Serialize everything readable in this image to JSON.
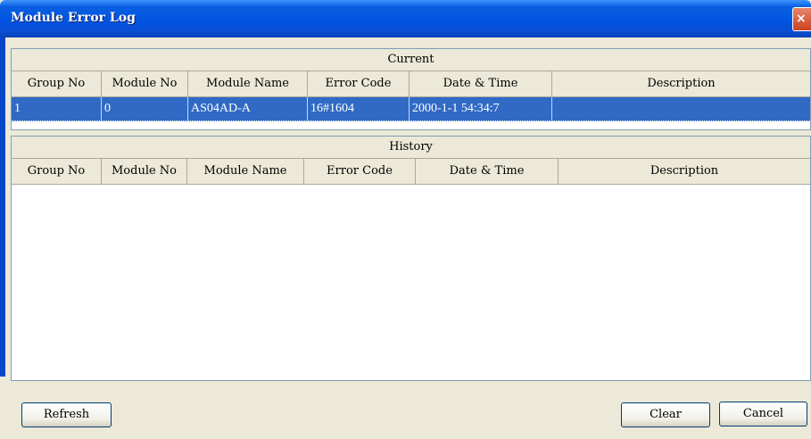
{
  "window": {
    "title": "Module Error Log",
    "close_glyph": "×"
  },
  "current": {
    "caption": "Current",
    "columns": [
      "Group No",
      "Module No",
      "Module Name",
      "Error Code",
      "Date & Time",
      "Description"
    ],
    "rows": [
      {
        "group_no": "1",
        "module_no": "0",
        "module_name": "AS04AD-A",
        "error_code": "16#1604",
        "date_time": "2000-1-1 54:34:7",
        "description": ""
      }
    ]
  },
  "history": {
    "caption": "History",
    "columns": [
      "Group No",
      "Module No",
      "Module Name",
      "Error Code",
      "Date & Time",
      "Description"
    ],
    "rows": []
  },
  "buttons": {
    "refresh": "Refresh",
    "clear": "Clear",
    "cancel": "Cancel"
  },
  "colors": {
    "titlebar": "#0054e3",
    "selection": "#316ac5",
    "dialog_bg": "#ece9d8"
  }
}
